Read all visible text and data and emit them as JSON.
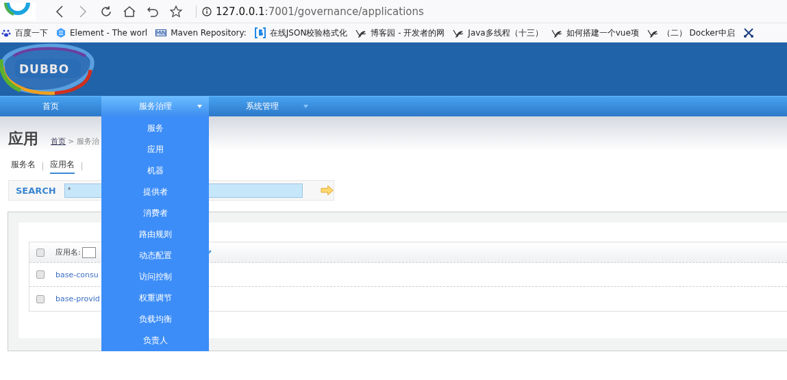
{
  "browser": {
    "url_host": "127.0.0.1",
    "url_path": ":7001/governance/applications",
    "bookmarks": [
      {
        "kind": "paw",
        "label": "百度一下"
      },
      {
        "kind": "hexagon",
        "label": "Element - The worl"
      },
      {
        "kind": "mvn",
        "label": "Maven Repository:"
      },
      {
        "kind": "bracket",
        "label": "在线JSON校验格式化"
      },
      {
        "kind": "sprout",
        "label": "博客园 - 开发者的网"
      },
      {
        "kind": "sprout",
        "label": "Java多线程（十三）"
      },
      {
        "kind": "sprout",
        "label": "如何搭建一个vue项"
      },
      {
        "kind": "sprout",
        "label": "（二） Docker中启"
      },
      {
        "kind": "scissors"
      }
    ]
  },
  "header": {
    "logo": "DUBBO"
  },
  "nav": [
    {
      "label": "首页",
      "selected": false,
      "kind": "link"
    },
    {
      "label": "服务治理",
      "selected": true,
      "kind": "dropdown",
      "expanded": true,
      "menu": [
        "服务",
        "应用",
        "机器",
        "提供者",
        "消费者",
        "路由规则",
        "动态配置",
        "访问控制",
        "权重调节",
        "负载均衡",
        "负责人"
      ]
    },
    {
      "label": "系统管理",
      "selected": false,
      "kind": "dropdown"
    }
  ],
  "page": {
    "title": "应用",
    "breadcrumb_home": "首页",
    "breadcrumb_trail": "> 服务治"
  },
  "tabs": [
    {
      "label": "服务名",
      "selected": false
    },
    {
      "label": "应用名",
      "selected": true
    }
  ],
  "search": {
    "label": "SEARCH",
    "value": "*"
  },
  "table": {
    "header_checked": false,
    "header_label": "应用名:",
    "rows": [
      {
        "name": "base-consu",
        "checked": false
      },
      {
        "name": "base-provid",
        "checked": false
      }
    ]
  }
}
